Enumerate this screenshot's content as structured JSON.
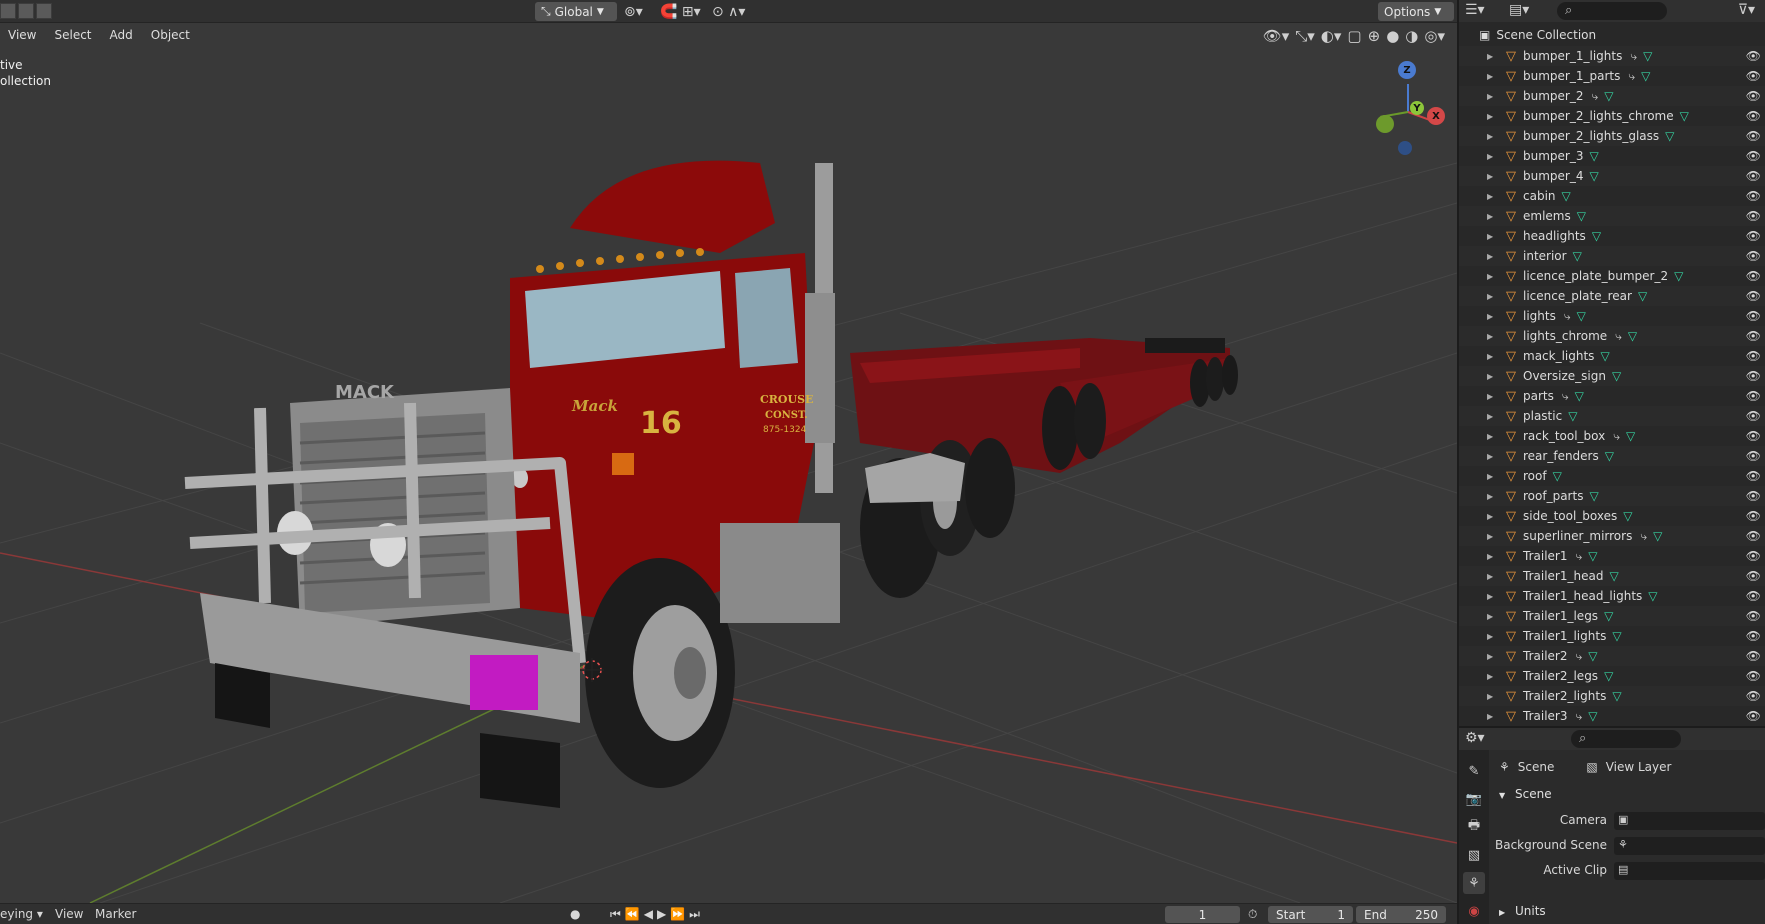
{
  "header": {
    "transform_orientation": "Global",
    "options_label": "Options"
  },
  "viewport": {
    "menu": [
      "View",
      "Select",
      "Add",
      "Object"
    ],
    "info_line1": "tive",
    "info_line2": "ollection",
    "truck_texts": {
      "brand": "Mack",
      "number": "16",
      "grill_badge": "MACK",
      "door_line1": "CROUSE",
      "door_line2": "CONST.",
      "door_line3": "875-1324"
    },
    "gizmo_axes": {
      "x": "X",
      "y": "Y",
      "z": "Z"
    }
  },
  "timeline": {
    "mode_label": "eying",
    "view_label": "View",
    "marker_label": "Marker",
    "current_frame": "1",
    "start_label": "Start",
    "start_value": "1",
    "end_label": "End",
    "end_value": "250"
  },
  "outliner": {
    "collection": "Scene Collection",
    "objects": [
      {
        "name": "bumper_1_lights",
        "modifier": true
      },
      {
        "name": "bumper_1_parts",
        "modifier": true
      },
      {
        "name": "bumper_2",
        "modifier": true
      },
      {
        "name": "bumper_2_lights_chrome",
        "modifier": false
      },
      {
        "name": "bumper_2_lights_glass",
        "modifier": false
      },
      {
        "name": "bumper_3",
        "modifier": false
      },
      {
        "name": "bumper_4",
        "modifier": false
      },
      {
        "name": "cabin",
        "modifier": false
      },
      {
        "name": "emlems",
        "modifier": false
      },
      {
        "name": "headlights",
        "modifier": false
      },
      {
        "name": "interior",
        "modifier": false
      },
      {
        "name": "licence_plate_bumper_2",
        "modifier": false
      },
      {
        "name": "licence_plate_rear",
        "modifier": false
      },
      {
        "name": "lights",
        "modifier": true
      },
      {
        "name": "lights_chrome",
        "modifier": true
      },
      {
        "name": "mack_lights",
        "modifier": false
      },
      {
        "name": "Oversize_sign",
        "modifier": false
      },
      {
        "name": "parts",
        "modifier": true
      },
      {
        "name": "plastic",
        "modifier": false
      },
      {
        "name": "rack_tool_box",
        "modifier": true
      },
      {
        "name": "rear_fenders",
        "modifier": false
      },
      {
        "name": "roof",
        "modifier": false
      },
      {
        "name": "roof_parts",
        "modifier": false
      },
      {
        "name": "side_tool_boxes",
        "modifier": false
      },
      {
        "name": "superliner_mirrors",
        "modifier": true
      },
      {
        "name": "Trailer1",
        "modifier": true
      },
      {
        "name": "Trailer1_head",
        "modifier": false
      },
      {
        "name": "Trailer1_head_lights",
        "modifier": false
      },
      {
        "name": "Trailer1_legs",
        "modifier": false
      },
      {
        "name": "Trailer1_lights",
        "modifier": false
      },
      {
        "name": "Trailer2",
        "modifier": true
      },
      {
        "name": "Trailer2_legs",
        "modifier": false
      },
      {
        "name": "Trailer2_lights",
        "modifier": false
      },
      {
        "name": "Trailer3",
        "modifier": true
      }
    ]
  },
  "properties": {
    "breadcrumb_scene": "Scene",
    "breadcrumb_view_layer": "View Layer",
    "panel_scene": "Scene",
    "camera_label": "Camera",
    "background_scene_label": "Background Scene",
    "active_clip_label": "Active Clip",
    "panel_units": "Units"
  },
  "icons": {
    "object": "object-triangle-icon",
    "mesh": "mesh-data-icon",
    "modifier": "modifier-icon",
    "eye": "eye-icon"
  },
  "colors": {
    "object_orange": "#e8963c",
    "mesh_green": "#35d2a0",
    "truck_red": "#8a0a0a",
    "trailer_red": "#7a1216",
    "plate_magenta": "#c21bc2"
  }
}
